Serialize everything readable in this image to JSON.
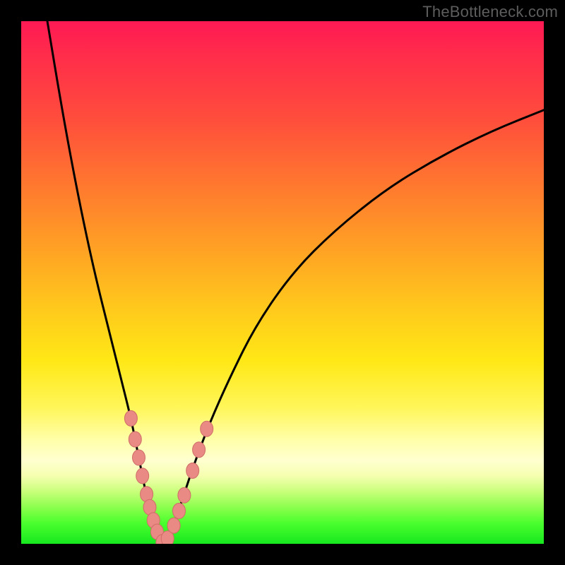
{
  "watermark": "TheBottleneck.com",
  "colors": {
    "frame": "#000000",
    "curve": "#000000",
    "marker_fill": "#e98a85",
    "marker_stroke": "#cf6d67"
  },
  "chart_data": {
    "type": "line",
    "title": "",
    "xlabel": "",
    "ylabel": "",
    "xlim": [
      0,
      100
    ],
    "ylim": [
      0,
      100
    ],
    "grid": false,
    "notes": "V-shaped bottleneck curve. Minimum (0% bottleneck) around x≈27. Left branch rises to 100 at x≈5; right branch rises toward ~83 at x=100. Salmon markers cluster on both branches near the trough region.",
    "series": [
      {
        "name": "bottleneck-curve",
        "x": [
          5,
          8,
          11,
          14,
          17,
          19,
          21,
          22,
          23,
          24,
          25,
          26,
          27,
          28,
          29,
          30,
          31,
          33,
          36,
          40,
          45,
          52,
          60,
          70,
          80,
          90,
          100
        ],
        "values": [
          100,
          82,
          66,
          52,
          40,
          32,
          24,
          19,
          14,
          9,
          5,
          2,
          0,
          1,
          3,
          6,
          9,
          15,
          23,
          32,
          42,
          52,
          60,
          68,
          74,
          79,
          83
        ]
      }
    ],
    "markers": {
      "name": "highlighted-points",
      "x": [
        21.0,
        21.8,
        22.5,
        23.2,
        24.0,
        24.6,
        25.3,
        26.0,
        27.0,
        28.0,
        29.2,
        30.2,
        31.2,
        32.8,
        34.0,
        35.5
      ],
      "values": [
        24.0,
        20.0,
        16.5,
        13.0,
        9.5,
        7.0,
        4.5,
        2.3,
        0.3,
        1.0,
        3.5,
        6.3,
        9.3,
        14.0,
        18.0,
        22.0
      ]
    }
  }
}
